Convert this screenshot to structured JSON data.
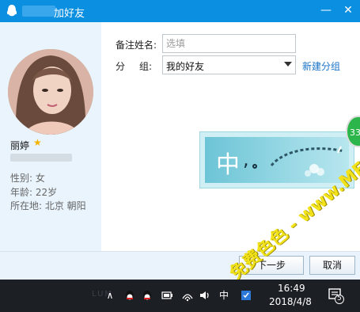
{
  "window": {
    "title": "加好友",
    "min_glyph": "—",
    "close_glyph": "✕"
  },
  "profile": {
    "nickname": "丽婷",
    "star_glyph": "★",
    "gender_label": "性别: 女",
    "age_label": "年龄: 22岁",
    "location_label": "所在地: 北京  朝阳"
  },
  "form": {
    "remark_label": "备注姓名:",
    "remark_placeholder": "选填",
    "group_label_1": "分",
    "group_label_2": "组:",
    "group_value": "我的好友",
    "new_group_link": "新建分组"
  },
  "ime_banner": {
    "big_char": "中",
    "punct": ","
  },
  "badge": {
    "text": "33"
  },
  "buttons": {
    "next": "下一步",
    "cancel": "取消"
  },
  "watermark": {
    "text": "免费色色 - www.MFsese.com"
  },
  "taskbar": {
    "faded_text": "LUM",
    "chevron": "∧",
    "ime_indicator": "中",
    "time": "16:49",
    "date": "2018/4/8",
    "notification_count": "5"
  },
  "colors": {
    "titlebar": "#0b8fe0",
    "link": "#1b74c9",
    "watermark": "#f2e21a",
    "badge": "#2cb54a",
    "taskbar": "#1c1f24"
  }
}
